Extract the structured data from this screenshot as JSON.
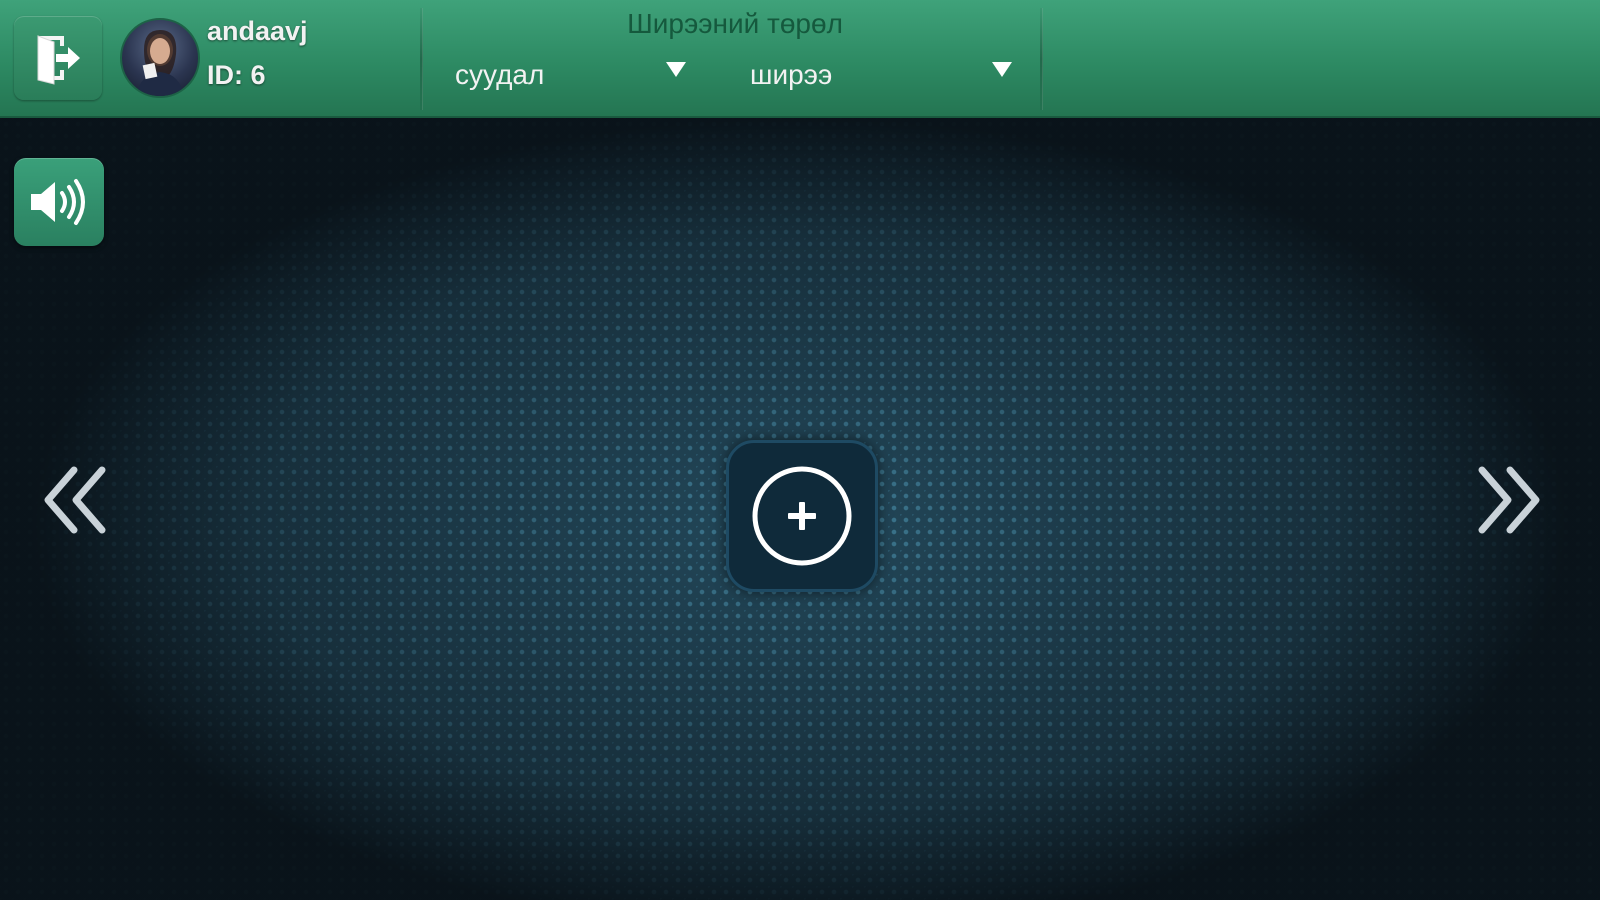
{
  "user": {
    "name": "andaavj",
    "id_label": "ID: 6"
  },
  "filter": {
    "title": "Ширээний төрөл",
    "seat_select": {
      "value": "суудал"
    },
    "table_select": {
      "value": "ширээ"
    }
  },
  "icons": {
    "exit": "exit-door-icon",
    "sound": "speaker-volume-icon",
    "prev": "double-chevron-left-icon",
    "next": "double-chevron-right-icon",
    "add": "plus-circle-icon"
  },
  "colors": {
    "header_green": "#2d8a63",
    "button_green": "#3aa07a",
    "background_teal": "#23485a",
    "title_dark_green": "#15593d"
  }
}
